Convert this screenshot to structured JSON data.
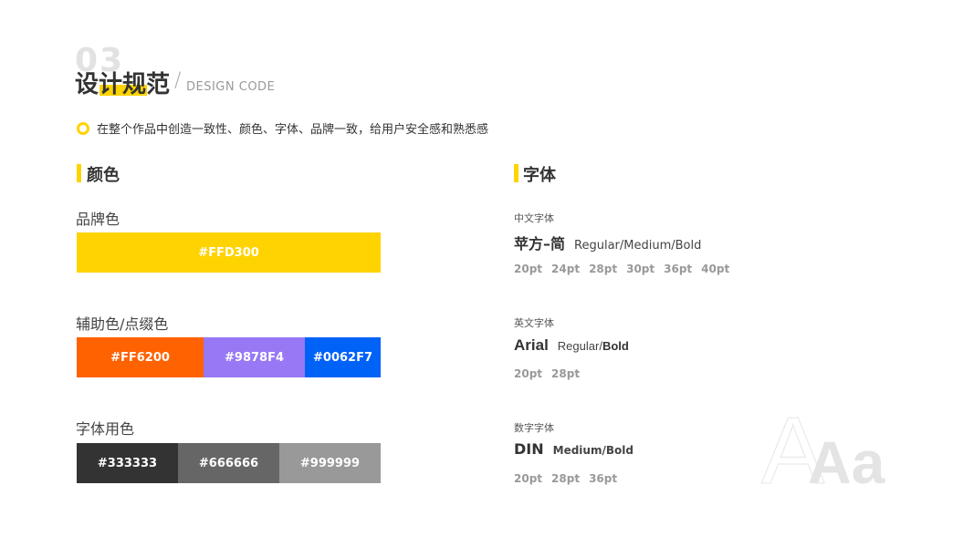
{
  "header": {
    "number": "03",
    "title": "设计规范",
    "separator": "/",
    "subtitle": "DESIGN CODE"
  },
  "intro": "在整个作品中创造一致性、颜色、字体、品牌一致，给用户安全感和熟悉感",
  "colors": {
    "heading": "颜色",
    "brand": {
      "label": "品牌色",
      "swatches": [
        {
          "hex": "#FFD300"
        }
      ]
    },
    "accent": {
      "label": "辅助色/点缀色",
      "swatches": [
        {
          "hex": "#FF6200"
        },
        {
          "hex": "#9878F4"
        },
        {
          "hex": "#0062F7"
        }
      ]
    },
    "text": {
      "label": "字体用色",
      "swatches": [
        {
          "hex": "#333333"
        },
        {
          "hex": "#666666"
        },
        {
          "hex": "#999999"
        }
      ]
    }
  },
  "fonts": {
    "heading": "字体",
    "chinese": {
      "label": "中文字体",
      "name": "苹方–简",
      "styles": "Regular/Medium/Bold",
      "sizes": [
        "20pt",
        "24pt",
        "28pt",
        "30pt",
        "36pt",
        "40pt"
      ]
    },
    "english": {
      "label": "英文字体",
      "name": "Arial",
      "style_regular": "Regular/",
      "style_bold": "Bold",
      "sizes": [
        "20pt",
        "28pt"
      ]
    },
    "number": {
      "label": "数字字体",
      "name": "DIN",
      "styles": "Medium/Bold",
      "sizes": [
        "20pt",
        "28pt",
        "36pt"
      ]
    },
    "decoration": "Aa"
  }
}
